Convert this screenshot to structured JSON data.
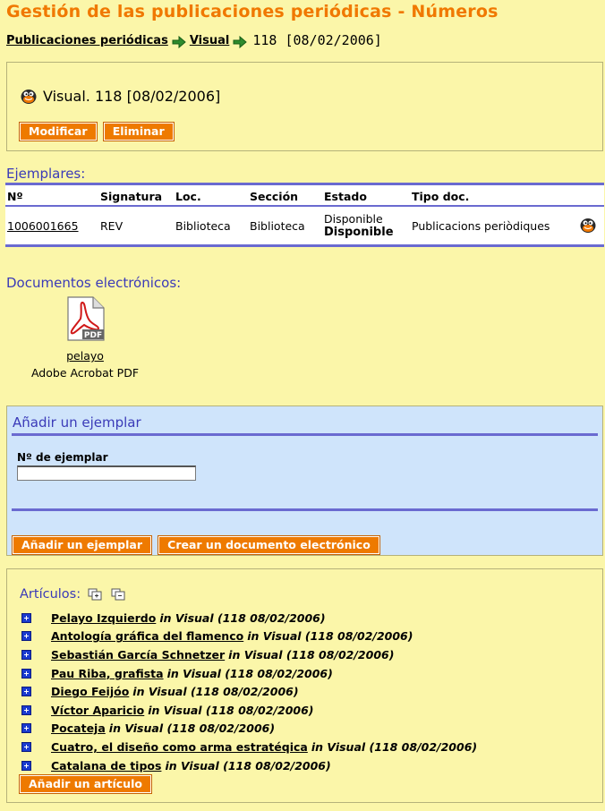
{
  "page_title": "Gestión de las publicaciones periódicas - Números",
  "breadcrumb": {
    "items": [
      "Publicaciones periódicas",
      "Visual"
    ],
    "current": "118 [08/02/2006]"
  },
  "record": {
    "title": "Visual. 118 [08/02/2006]",
    "modify_label": "Modificar",
    "delete_label": "Eliminar"
  },
  "copies": {
    "heading": "Ejemplares:",
    "columns": [
      "Nº",
      "Signatura",
      "Loc.",
      "Sección",
      "Estado",
      "Tipo doc."
    ],
    "rows": [
      {
        "numero": "1006001665",
        "signatura": "REV",
        "loc": "Biblioteca",
        "seccion": "Biblioteca",
        "estado": "Disponible",
        "estado_detalle": "Disponible",
        "tipo_doc": "Publicacions periòdiques"
      }
    ]
  },
  "electronic_docs": {
    "heading": "Documentos electrónicos:",
    "items": [
      {
        "name": "pelayo",
        "type": "Adobe Acrobat PDF",
        "icon": "pdf-file-icon",
        "icon_label": "PDF"
      }
    ]
  },
  "add_copy": {
    "heading": "Añadir un ejemplar",
    "field_label": "Nº de ejemplar",
    "field_value": "",
    "add_button": "Añadir un ejemplar",
    "create_doc_button": "Crear un documento electrónico"
  },
  "articles": {
    "heading": "Artículos:",
    "items": [
      {
        "title": "Pelayo Izquierdo",
        "source": "in Visual (118 08/02/2006)"
      },
      {
        "title": "Antología gráfica del flamenco",
        "source": "in Visual (118 08/02/2006)"
      },
      {
        "title": "Sebastián García Schnetzer",
        "source": "in Visual (118 08/02/2006)"
      },
      {
        "title": "Pau Riba, grafista",
        "source": "in Visual (118 08/02/2006)"
      },
      {
        "title": "Diego Feijóo",
        "source": "in Visual (118 08/02/2006)"
      },
      {
        "title": "Víctor Aparicio",
        "source": "in Visual (118 08/02/2006)"
      },
      {
        "title": "Pocateja",
        "source": "in Visual (118 08/02/2006)"
      },
      {
        "title": "Cuatro, el diseño como arma estratéqica",
        "source": "in Visual (118 08/02/2006)"
      },
      {
        "title": "Catalana de tipos",
        "source": "in Visual (118 08/02/2006)"
      }
    ],
    "add_button": "Añadir un artículo"
  },
  "colors": {
    "background": "#fbf6a9",
    "title_orange": "#f07800",
    "button_orange": "#ee7a00",
    "heading_blue": "#3a3ab8",
    "panel_blue": "#cfe4fb"
  }
}
